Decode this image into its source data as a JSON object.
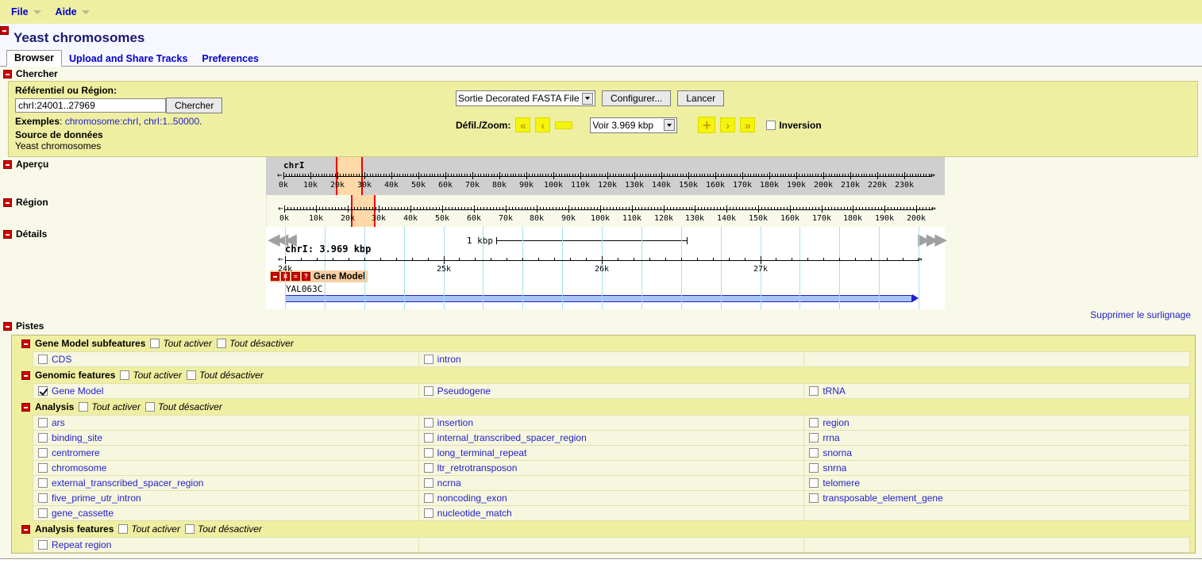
{
  "menubar": {
    "items": [
      {
        "label": "File"
      },
      {
        "label": "Aide"
      }
    ]
  },
  "page": {
    "title": "Yeast chromosomes",
    "clear_highlight_label": "Supprimer le surlignage"
  },
  "tabs": [
    {
      "label": "Browser",
      "active": true
    },
    {
      "label": "Upload and Share Tracks",
      "active": false
    },
    {
      "label": "Preferences",
      "active": false
    }
  ],
  "sections": {
    "chercher": "Chercher",
    "apercu": "Aperçu",
    "region": "Région",
    "details": "Détails",
    "pistes": "Pistes"
  },
  "search": {
    "landmark_label": "Référentiel ou Région:",
    "input_value": "chrI:24001..27969",
    "search_button": "Chercher",
    "examples_label": "Exemples",
    "example_1": "chromosome:chrI",
    "example_2": "chrI:1..50000",
    "source_label": "Source de données",
    "source_value": "Yeast chromosomes",
    "output_select": "Sortie Decorated FASTA File",
    "configure_button": "Configurer...",
    "go_button": "Lancer",
    "scroll_zoom_label": "Défil./Zoom:",
    "zoom_select": "Voir 3.969 kbp",
    "flip_label": "Inversion",
    "flip_checked": false,
    "nav": {
      "far_left": "«",
      "left": "‹",
      "zoom_out": "—",
      "zoom_in": "+",
      "right": "›",
      "far_right": "»"
    }
  },
  "overview": {
    "chromosome": "chrI",
    "ticks": [
      "0k",
      "10k",
      "20k",
      "30k",
      "40k",
      "50k",
      "60k",
      "70k",
      "80k",
      "90k",
      "100k",
      "110k",
      "120k",
      "130k",
      "140k",
      "150k",
      "160k",
      "170k",
      "180k",
      "190k",
      "200k",
      "210k",
      "220k",
      "230k"
    ],
    "range_start": 0,
    "range_end": 240000,
    "highlight_start": 24001,
    "highlight_end": 27969
  },
  "region": {
    "ticks": [
      "0k",
      "10k",
      "20k",
      "30k",
      "40k",
      "50k",
      "60k",
      "70k",
      "80k",
      "90k",
      "100k",
      "110k",
      "120k",
      "130k",
      "140k",
      "150k",
      "160k",
      "170k",
      "180k",
      "190k",
      "200k"
    ],
    "range_start": 0,
    "range_end": 205000,
    "highlight_start": 24001,
    "highlight_end": 27969
  },
  "detail": {
    "title": "chrI: 3.969 kbp",
    "scalebar_label": "1 kbp",
    "ticks": [
      "24k",
      "25k",
      "26k",
      "27k"
    ],
    "range_start": 24001,
    "range_end": 27969,
    "track": {
      "name": "Gene Model",
      "buttons": [
        "minus-icon",
        "close-icon",
        "share-icon",
        "help-icon"
      ],
      "feature_label": "YAL063C"
    }
  },
  "track_groups": [
    {
      "title": "Gene Model subfeatures",
      "enable_all": "Tout activer",
      "disable_all": "Tout désactiver",
      "rows": [
        [
          {
            "label": "CDS",
            "checked": false
          },
          {
            "label": "intron",
            "checked": false
          },
          {
            "label": "",
            "checked": null
          }
        ]
      ]
    },
    {
      "title": "Genomic features",
      "enable_all": "Tout activer",
      "disable_all": "Tout désactiver",
      "rows": [
        [
          {
            "label": "Gene Model",
            "checked": true
          },
          {
            "label": "Pseudogene",
            "checked": false
          },
          {
            "label": "tRNA",
            "checked": false
          }
        ]
      ]
    },
    {
      "title": "Analysis",
      "enable_all": "Tout activer",
      "disable_all": "Tout désactiver",
      "rows": [
        [
          {
            "label": "ars",
            "checked": false
          },
          {
            "label": "insertion",
            "checked": false
          },
          {
            "label": "region",
            "checked": false
          }
        ],
        [
          {
            "label": "binding_site",
            "checked": false
          },
          {
            "label": "internal_transcribed_spacer_region",
            "checked": false
          },
          {
            "label": "rrna",
            "checked": false
          }
        ],
        [
          {
            "label": "centromere",
            "checked": false
          },
          {
            "label": "long_terminal_repeat",
            "checked": false
          },
          {
            "label": "snorna",
            "checked": false
          }
        ],
        [
          {
            "label": "chromosome",
            "checked": false
          },
          {
            "label": "ltr_retrotransposon",
            "checked": false
          },
          {
            "label": "snrna",
            "checked": false
          }
        ],
        [
          {
            "label": "external_transcribed_spacer_region",
            "checked": false
          },
          {
            "label": "ncrna",
            "checked": false
          },
          {
            "label": "telomere",
            "checked": false
          }
        ],
        [
          {
            "label": "five_prime_utr_intron",
            "checked": false
          },
          {
            "label": "noncoding_exon",
            "checked": false
          },
          {
            "label": "transposable_element_gene",
            "checked": false
          }
        ],
        [
          {
            "label": "gene_cassette",
            "checked": false
          },
          {
            "label": "nucleotide_match",
            "checked": false
          },
          {
            "label": "",
            "checked": null
          }
        ]
      ]
    },
    {
      "title": "Analysis features",
      "enable_all": "Tout activer",
      "disable_all": "Tout désactiver",
      "rows": [
        [
          {
            "label": "Repeat region",
            "checked": false
          },
          {
            "label": "",
            "checked": null
          },
          {
            "label": "",
            "checked": null
          }
        ]
      ]
    }
  ],
  "colors": {
    "panel_yellow": "#efefa2",
    "page_bg": "#f9f9ea",
    "link_blue": "#2222cc",
    "nav_yellow": "#f4f40c",
    "highlight_red": "#ee0000",
    "highlight_band": "#ffd9a8",
    "track_header": "#f7cfa0",
    "gene_blue": "#2222cc"
  }
}
